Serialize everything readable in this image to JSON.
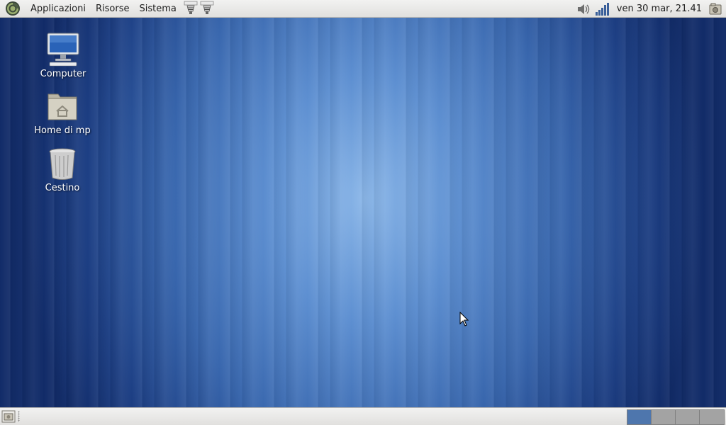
{
  "top_panel": {
    "menus": [
      "Applicazioni",
      "Risorse",
      "Sistema"
    ],
    "clock": "ven 30 mar, 21.41"
  },
  "desktop": {
    "icons": [
      {
        "label": "Computer",
        "icon": "computer-icon"
      },
      {
        "label": "Home di mp",
        "icon": "home-folder-icon"
      },
      {
        "label": "Cestino",
        "icon": "trash-icon"
      }
    ]
  },
  "bottom_panel": {
    "workspaces": 4,
    "active_workspace": 1
  },
  "colors": {
    "panel": "#e6e5e3",
    "active_workspace": "#4e76ad",
    "inactive_workspace": "#a3a3a3"
  }
}
